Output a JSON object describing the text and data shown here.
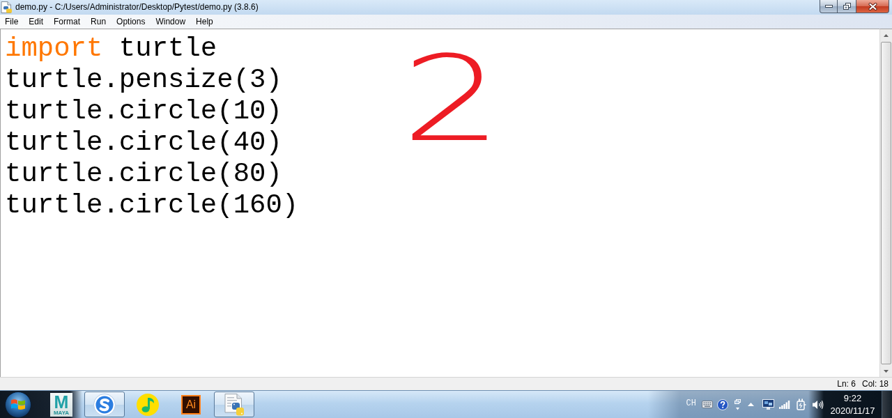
{
  "window": {
    "title": "demo.py - C:/Users/Administrator/Desktop/Pytest/demo.py (3.8.6)"
  },
  "menu_bar": {
    "items": [
      "File",
      "Edit",
      "Format",
      "Run",
      "Options",
      "Window",
      "Help"
    ]
  },
  "editor": {
    "lines": [
      {
        "tokens": [
          {
            "kind": "keyword",
            "text": "import"
          },
          {
            "kind": "plain",
            "text": " turtle"
          }
        ]
      },
      {
        "tokens": [
          {
            "kind": "plain",
            "text": "turtle.pensize(3)"
          }
        ]
      },
      {
        "tokens": [
          {
            "kind": "plain",
            "text": "turtle.circle(10)"
          }
        ]
      },
      {
        "tokens": [
          {
            "kind": "plain",
            "text": "turtle.circle(40)"
          }
        ]
      },
      {
        "tokens": [
          {
            "kind": "plain",
            "text": "turtle.circle(80)"
          }
        ]
      },
      {
        "tokens": [
          {
            "kind": "plain",
            "text": "turtle.circle(160)"
          }
        ]
      }
    ],
    "annotation": "2"
  },
  "status_bar": {
    "line": "Ln: 6",
    "column": "Col: 18"
  },
  "taskbar": {
    "apps": [
      {
        "kind": "letter-tile",
        "logo": "M",
        "caption": "MAYA",
        "running": false
      },
      {
        "kind": "s-disc",
        "running": true
      },
      {
        "kind": "note-disc",
        "running": false
      },
      {
        "kind": "letter-square",
        "logo": "Ai",
        "running": false
      },
      {
        "kind": "script-file",
        "running": true
      }
    ],
    "tray": {
      "language": "CH"
    },
    "clock": {
      "time": "9:22",
      "date": "2020/11/17"
    }
  }
}
